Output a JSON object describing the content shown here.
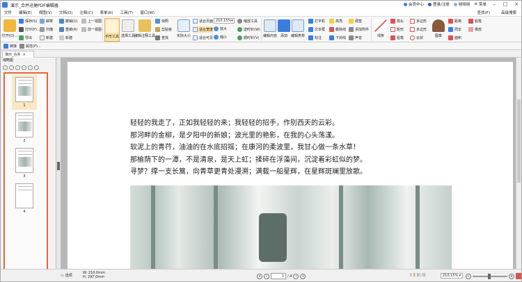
{
  "app": {
    "title": "演示_合并迅捷PDF编辑器"
  },
  "titlebar": {
    "member": "会员中心",
    "login": "登录/注册",
    "user": "晓晓晓",
    "menu": "菜单"
  },
  "menu": {
    "items": [
      "文件",
      "编辑(E)",
      "视图(V)",
      "文档(D)",
      "注释(C)",
      "表单(R)",
      "工具(T)",
      "窗口(W)"
    ],
    "find": "查找(F)",
    "advanced_find": "高级搜索"
  },
  "ribbon": {
    "open": "打开(O)...",
    "col1": [
      "保存(S)",
      "打印(P)...",
      "导出"
    ],
    "col2": [
      "邮寄",
      "扫描",
      "新建"
    ],
    "col3": [
      "撤销(U)",
      "重做(R)",
      "新建"
    ],
    "col4": [
      "上一视图",
      "前一视图",
      ""
    ],
    "hand": "手形工具",
    "select": "选择工具",
    "edit_content": "编辑注释工具",
    "col5": [
      "快照",
      "剪贴板",
      "查找"
    ],
    "actual": "实际大小",
    "col6": [
      "适合页面",
      "适合宽度",
      "适合可见"
    ],
    "zoom": "210.15%",
    "col7": [
      "放大",
      "缩小"
    ],
    "col8": [
      "缩放工具",
      "逆时针(W)",
      "顺时针(V)"
    ],
    "edit_form": "编辑内容",
    "add": "添加",
    "edit_text": "编辑表单",
    "col9": [
      "打字机",
      "文本框",
      "标注"
    ],
    "col10": [
      "高亮",
      "删除线",
      "下划线"
    ],
    "col11": [
      "便签",
      "添加附件",
      "声音"
    ],
    "line": "线条",
    "col12": [
      "箭头",
      "矩形",
      "铅笔"
    ],
    "col13": [
      "多边形",
      "多边形",
      "云状"
    ],
    "stamp": "图章",
    "col14": [
      "距离",
      "周长",
      "面积"
    ],
    "col15": [
      "铅笔",
      "橡皮"
    ]
  },
  "ribbon2": {
    "a": "链接",
    "b": "属性(P)..."
  },
  "tab": {
    "label": "演示_合并"
  },
  "sidebar": {
    "title": "缩略图",
    "pages": [
      "1",
      "2",
      "3",
      "4"
    ]
  },
  "poem": {
    "lines": [
      "轻轻的我走了，正如我轻轻的来；我轻轻的招手，作别西天的云彩。",
      "那河畔的金柳，是夕阳中的新娘；波光里的艳影，在我的心头荡漾。",
      "软泥上的青荇，油油的在水底招摇；在康河的柔波里，我甘心做一条水草！",
      "那榆荫下的一潭，不是清泉，是天上虹；揉碎在浮藻间，沉淀着彩虹似的梦。",
      "寻梦？撑一支长篙，向青草更青处漫溯；满载一船星辉，在星辉斑斓里放歌。"
    ]
  },
  "status": {
    "select": "选项",
    "size_w": "W: 210.0mm",
    "size_h": "H: 297.0mm",
    "page_current": "1",
    "page_total": "/ 4",
    "zoom": "210.15%"
  }
}
